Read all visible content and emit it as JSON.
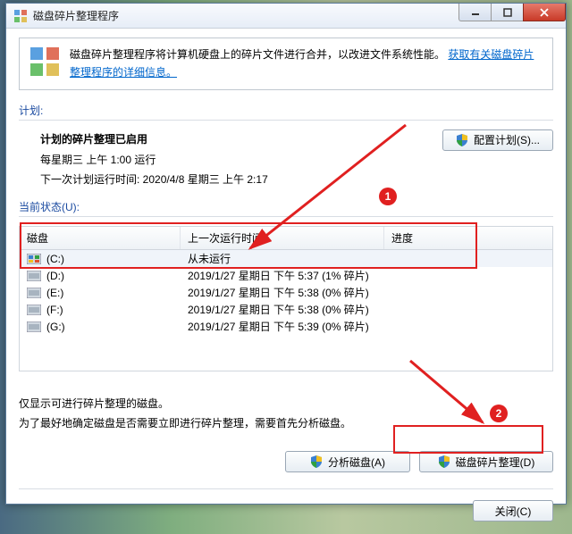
{
  "window": {
    "title": "磁盘碎片整理程序"
  },
  "info": {
    "text": "磁盘碎片整理程序将计算机硬盘上的碎片文件进行合并，以改进文件系统性能。",
    "link": "获取有关磁盘碎片整理程序的详细信息。"
  },
  "schedule_label": "计划:",
  "schedule": {
    "title": "计划的碎片整理已启用",
    "line1": "每星期三  上午 1:00 运行",
    "line2": "下一次计划运行时间:  2020/4/8 星期三 上午 2:17",
    "config_btn": "配置计划(S)..."
  },
  "status_label": "当前状态(U):",
  "table": {
    "headers": {
      "disk": "磁盘",
      "last": "上一次运行时间",
      "progress": "进度"
    },
    "rows": [
      {
        "name": "(C:)",
        "icon": "win",
        "last": "从未运行",
        "selected": true
      },
      {
        "name": "(D:)",
        "icon": "hdd",
        "last": "2019/1/27 星期日 下午 5:37 (1% 碎片)"
      },
      {
        "name": "(E:)",
        "icon": "hdd",
        "last": "2019/1/27 星期日 下午 5:38 (0% 碎片)"
      },
      {
        "name": "(F:)",
        "icon": "hdd",
        "last": "2019/1/27 星期日 下午 5:38 (0% 碎片)"
      },
      {
        "name": "(G:)",
        "icon": "hdd",
        "last": "2019/1/27 星期日 下午 5:39 (0% 碎片)"
      }
    ]
  },
  "hint": {
    "line1": "仅显示可进行碎片整理的磁盘。",
    "line2": "为了最好地确定磁盘是否需要立即进行碎片整理，需要首先分析磁盘。"
  },
  "buttons": {
    "analyze": "分析磁盘(A)",
    "defrag": "磁盘碎片整理(D)",
    "close": "关闭(C)"
  },
  "annotations": {
    "badge1": "1",
    "badge2": "2"
  }
}
